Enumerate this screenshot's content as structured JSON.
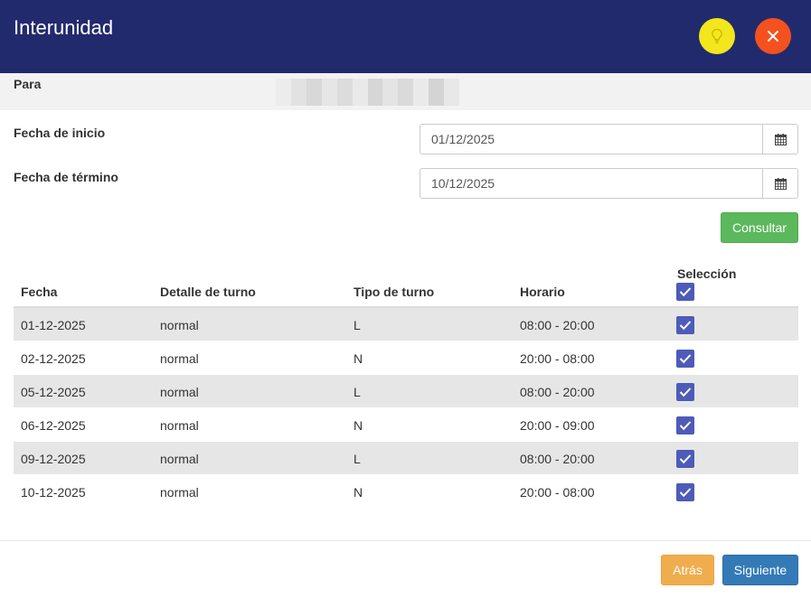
{
  "header": {
    "title": "Interunidad",
    "hint_icon": "lightbulb-icon",
    "close_icon": "close-icon",
    "colors": {
      "background": "#222a6e",
      "hint": "#f3e61c",
      "close": "#f4511e"
    }
  },
  "para": {
    "label": "Para"
  },
  "form": {
    "start_label": "Fecha de inicio",
    "start_value": "01/12/2025",
    "end_label": "Fecha de término",
    "end_value": "10/12/2025",
    "calendar_icon": "calendar-icon",
    "consultar_label": "Consultar"
  },
  "table": {
    "columns": [
      "Fecha",
      "Detalle de turno",
      "Tipo de turno",
      "Horario",
      "Selección"
    ],
    "select_all_checked": true,
    "rows": [
      {
        "fecha": "01-12-2025",
        "detalle": "normal",
        "tipo": "L",
        "horario": "08:00 - 20:00",
        "selected": true
      },
      {
        "fecha": "02-12-2025",
        "detalle": "normal",
        "tipo": "N",
        "horario": "20:00 - 08:00",
        "selected": true
      },
      {
        "fecha": "05-12-2025",
        "detalle": "normal",
        "tipo": "L",
        "horario": "08:00 - 20:00",
        "selected": true
      },
      {
        "fecha": "06-12-2025",
        "detalle": "normal",
        "tipo": "N",
        "horario": "20:00 - 09:00",
        "selected": true
      },
      {
        "fecha": "09-12-2025",
        "detalle": "normal",
        "tipo": "L",
        "horario": "08:00 - 20:00",
        "selected": true
      },
      {
        "fecha": "10-12-2025",
        "detalle": "normal",
        "tipo": "N",
        "horario": "20:00 - 08:00",
        "selected": true
      }
    ]
  },
  "footer": {
    "back_label": "Atrás",
    "next_label": "Siguiente"
  }
}
